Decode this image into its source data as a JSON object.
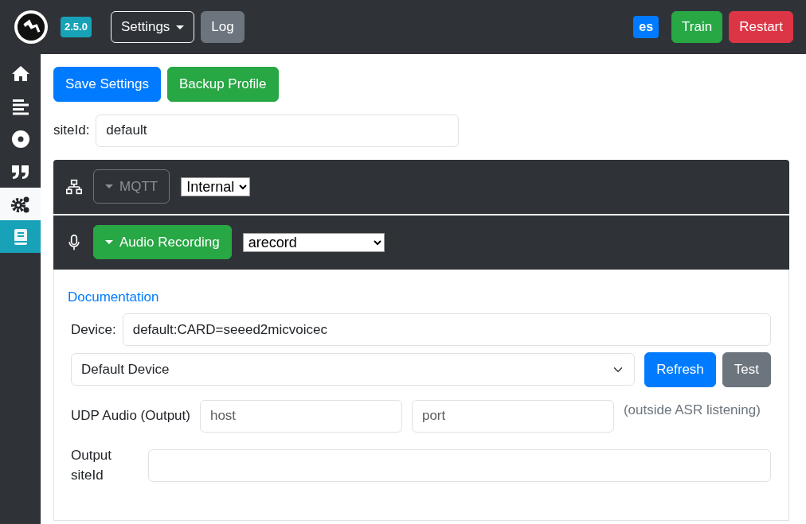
{
  "navbar": {
    "version": "2.5.0",
    "settings_menu": "Settings",
    "log_button": "Log",
    "language": "es",
    "train_button": "Train",
    "restart_button": "Restart"
  },
  "sidebar": {
    "items": [
      {
        "kind": "home",
        "selected": false
      },
      {
        "kind": "lines",
        "selected": false
      },
      {
        "kind": "record",
        "selected": false
      },
      {
        "kind": "quote",
        "selected": false
      },
      {
        "kind": "gears",
        "selected": true
      },
      {
        "kind": "book",
        "selected": false
      }
    ]
  },
  "actions": [
    "Save Settings",
    "Backup Profile"
  ],
  "site_id": {
    "label": "siteId:",
    "value": "default"
  },
  "sections": [
    {
      "kind": "network",
      "title": "MQTT",
      "expanded": false,
      "option": "Internal"
    },
    {
      "kind": "microphone",
      "title": "Audio Recording",
      "expanded": true,
      "option": "arecord"
    }
  ],
  "audio": {
    "documentation_link": "Documentation",
    "device_label": "Device:",
    "device_value": "default:CARD=seeed2micvoicec",
    "device_select": "Default Device",
    "refresh_button": "Refresh",
    "test_button": "Test",
    "udp_label": "UDP Audio (Output)",
    "host_placeholder": "host",
    "port_placeholder": "port",
    "udp_note": "(outside ASR listening)",
    "output_label": "Output siteId"
  }
}
